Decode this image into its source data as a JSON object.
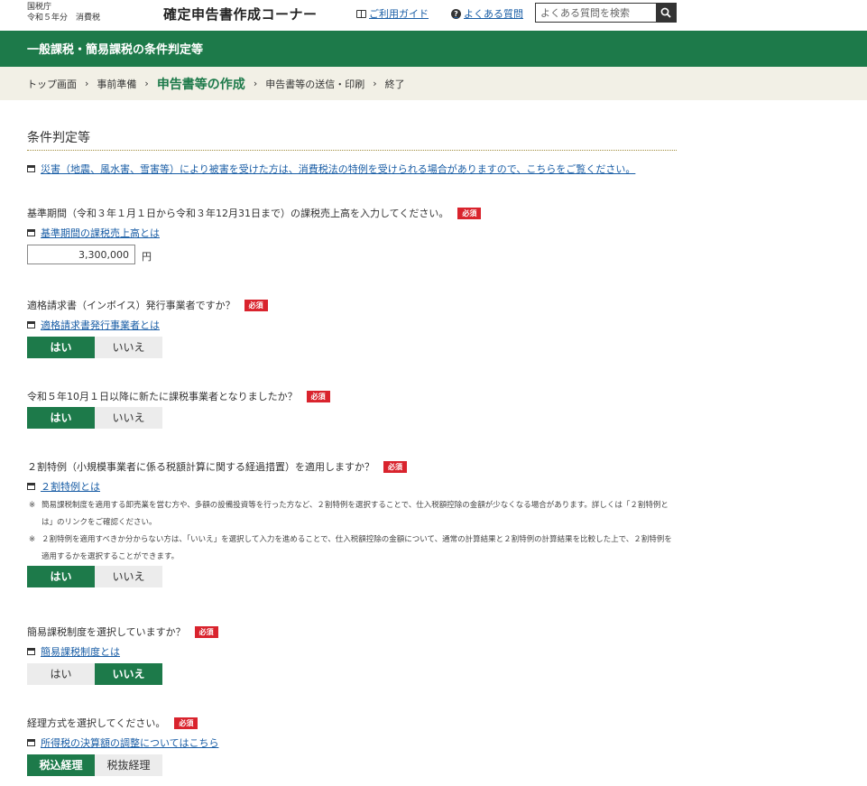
{
  "header": {
    "agency_line1": "国税庁",
    "agency_line2": "令和５年分　消費税",
    "title": "確定申告書作成コーナー",
    "guide_link": "ご利用ガイド",
    "faq_link": "よくある質問",
    "search_placeholder": "よくある質問を検索"
  },
  "page_banner": "一般課税・簡易課税の条件判定等",
  "breadcrumb": {
    "steps": [
      "トップ画面",
      "事前準備",
      "申告書等の作成",
      "申告書等の送信・印刷",
      "終了"
    ],
    "separator": "›",
    "current_index": 2
  },
  "section": {
    "title": "条件判定等",
    "disaster_link": "災害（地震、風水害、雪害等）により被害を受けた方は、消費税法の特例を受けられる場合がありますので、こちらをご覧ください。"
  },
  "required_label": "必須",
  "q1": {
    "text": "基準期間（令和３年１月１日から令和３年12月31日まで）の課税売上高を入力してください。",
    "link": "基準期間の課税売上高とは",
    "value": "3,300,000",
    "unit": "円"
  },
  "q2": {
    "text": "適格請求書（インボイス）発行事業者ですか？",
    "link": "適格請求書発行事業者とは",
    "yes": "はい",
    "no": "いいえ",
    "selected": "yes"
  },
  "q3": {
    "text": "令和５年10月１日以降に新たに課税事業者となりましたか？",
    "yes": "はい",
    "no": "いいえ",
    "selected": "yes"
  },
  "q4": {
    "text": "２割特例（小規模事業者に係る税額計算に関する経過措置）を適用しますか？",
    "link": "２割特例とは",
    "note_mark": "※",
    "note1": "簡易課税制度を適用する卸売業を営む方や、多額の設備投資等を行った方など、２割特例を選択することで、仕入税額控除の金額が少なくなる場合があります。詳しくは「２割特例とは」のリンクをご確認ください。",
    "note2": "２割特例を適用すべきか分からない方は、「いいえ」を選択して入力を進めることで、仕入税額控除の金額について、通常の計算結果と２割特例の計算結果を比較した上で、２割特例を適用するかを選択することができます。",
    "yes": "はい",
    "no": "いいえ",
    "selected": "yes"
  },
  "q5": {
    "text": "簡易課税制度を選択していますか？",
    "link": "簡易課税制度とは",
    "yes": "はい",
    "no": "いいえ",
    "selected": "no"
  },
  "q6": {
    "text": "経理方式を選択してください。",
    "link": "所得税の決算額の調整についてはこちら",
    "opt1": "税込経理",
    "opt2": "税抜経理",
    "selected": "opt1"
  }
}
